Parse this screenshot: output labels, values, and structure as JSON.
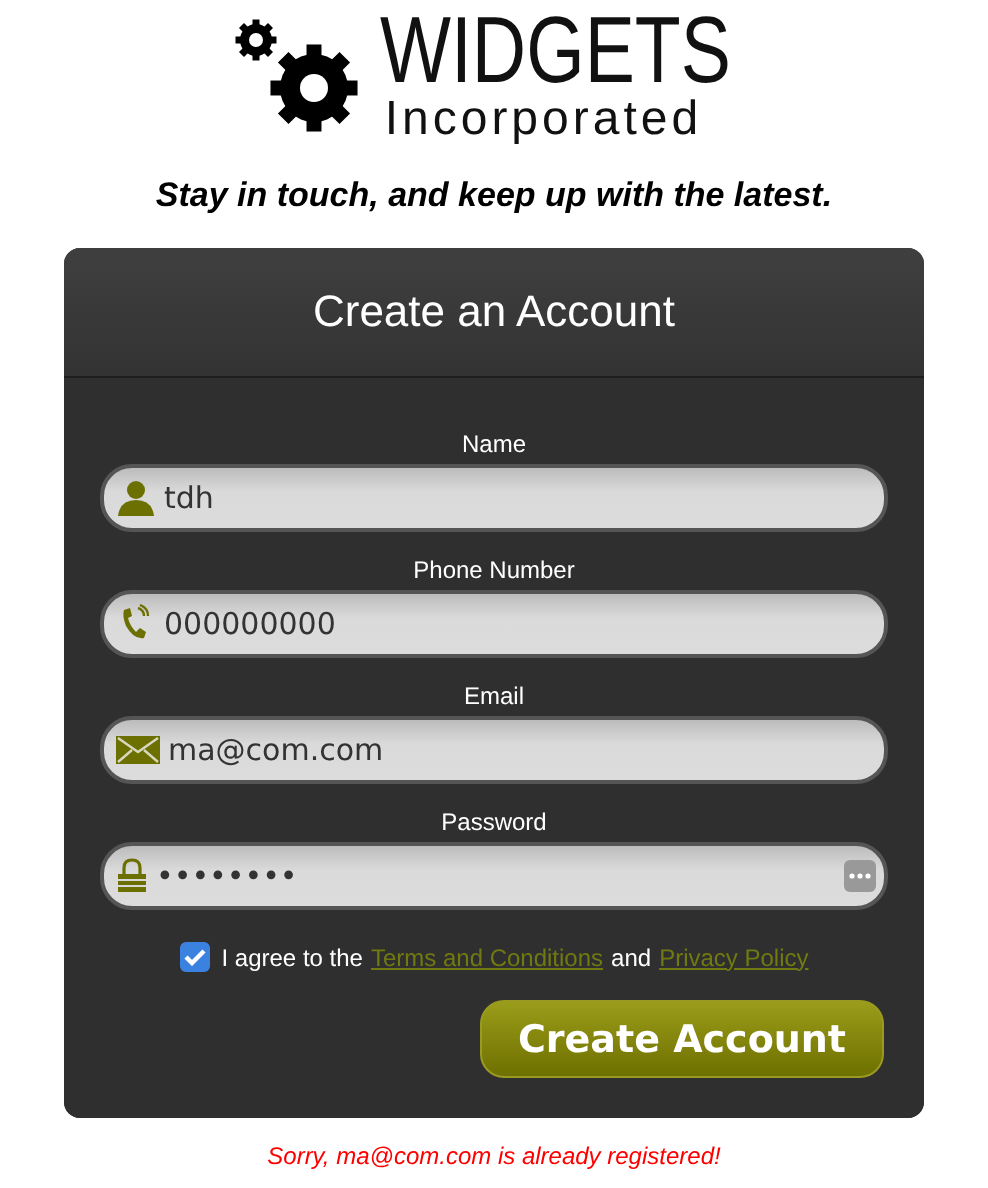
{
  "logo": {
    "title": "WIDGETS",
    "subtitle": "Incorporated"
  },
  "tagline": "Stay in touch, and keep up with the latest.",
  "form": {
    "title": "Create an Account",
    "fields": [
      {
        "label": "Name",
        "kind": "person",
        "value": "tdh"
      },
      {
        "label": "Phone Number",
        "kind": "phone",
        "value": "000000000"
      },
      {
        "label": "Email",
        "kind": "mail",
        "value": "ma@com.com"
      },
      {
        "label": "Password",
        "kind": "lock",
        "value": "••••••••",
        "manager": true
      }
    ],
    "agree": {
      "checked": true,
      "before": "I agree to the",
      "link1": "Terms and Conditions",
      "middle": "and",
      "link2": "Privacy Policy"
    },
    "submit": "Create Account"
  },
  "error": "Sorry, ma@com.com is already registered!"
}
